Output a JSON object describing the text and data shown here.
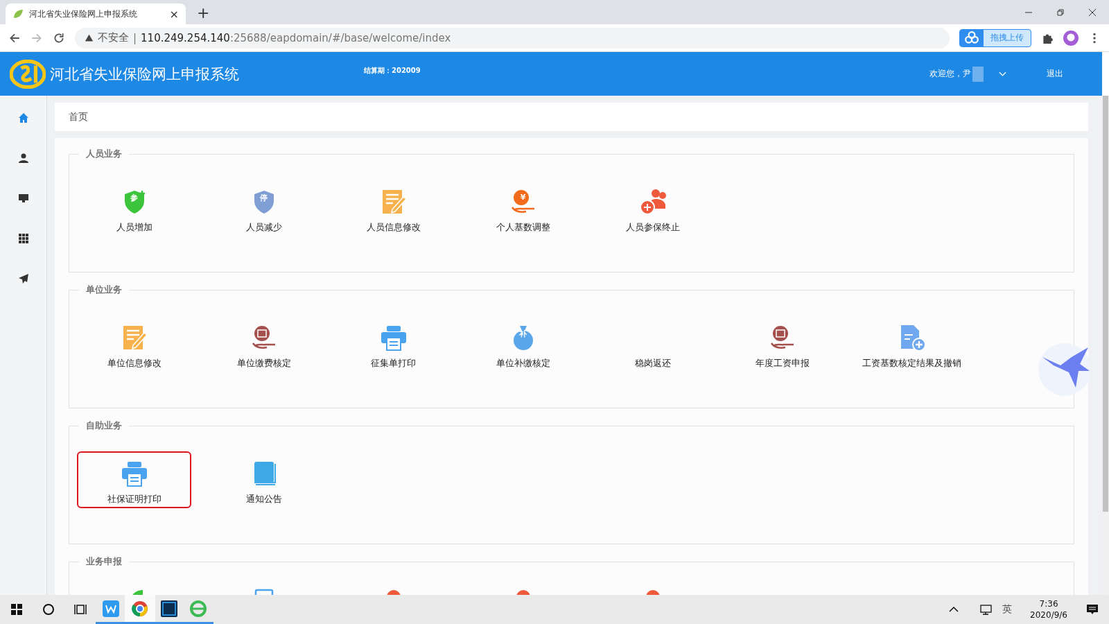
{
  "browser": {
    "tab": {
      "title": "河北省失业保险网上申报系统",
      "close": "×"
    },
    "new_tab": "+",
    "address": {
      "security": "不安全",
      "separator": "|",
      "host": "110.249.254.140",
      "path": ":25688/eapdomain/#/base/welcome/index"
    },
    "extension_button": "拖拽上传"
  },
  "header": {
    "title": "河北省失业保险网上申报系统",
    "period_label": "结算期：",
    "period": "202009",
    "welcome": "欢迎您，尹",
    "logout": "退出"
  },
  "sidebar": {
    "items": [
      {
        "selected": true
      },
      {
        "selected": false
      },
      {
        "selected": false
      },
      {
        "selected": false
      },
      {
        "selected": false
      }
    ]
  },
  "breadcrumb": "首页",
  "sections": [
    {
      "title": "人员业务",
      "items": [
        {
          "label": "人员增加",
          "glyph": "参",
          "highlighted": false
        },
        {
          "label": "人员减少",
          "glyph": "停",
          "highlighted": false
        },
        {
          "label": "人员信息修改",
          "highlighted": false
        },
        {
          "label": "个人基数调整",
          "glyph": "¥",
          "highlighted": false
        },
        {
          "label": "人员参保终止",
          "highlighted": false
        }
      ]
    },
    {
      "title": "单位业务",
      "items": [
        {
          "label": "单位信息修改",
          "highlighted": false
        },
        {
          "label": "单位缴费核定",
          "highlighted": false
        },
        {
          "label": "征集单打印",
          "highlighted": false
        },
        {
          "label": "单位补缴核定",
          "glyph": "补",
          "highlighted": false
        },
        {
          "label": "稳岗返还",
          "highlighted": false
        },
        {
          "label": "年度工资申报",
          "highlighted": false
        },
        {
          "label": "工资基数核定结果及撤销",
          "highlighted": false
        }
      ]
    },
    {
      "title": "自助业务",
      "items": [
        {
          "label": "社保证明打印",
          "highlighted": true
        },
        {
          "label": "通知公告",
          "highlighted": false
        }
      ]
    },
    {
      "title": "业务申报",
      "items": [
        {
          "highlighted": false
        },
        {
          "highlighted": false
        },
        {
          "highlighted": false
        },
        {
          "highlighted": false
        },
        {
          "highlighted": false
        }
      ]
    }
  ],
  "taskbar": {
    "ime": "英",
    "time": "7:36",
    "date": "2020/9/6"
  }
}
